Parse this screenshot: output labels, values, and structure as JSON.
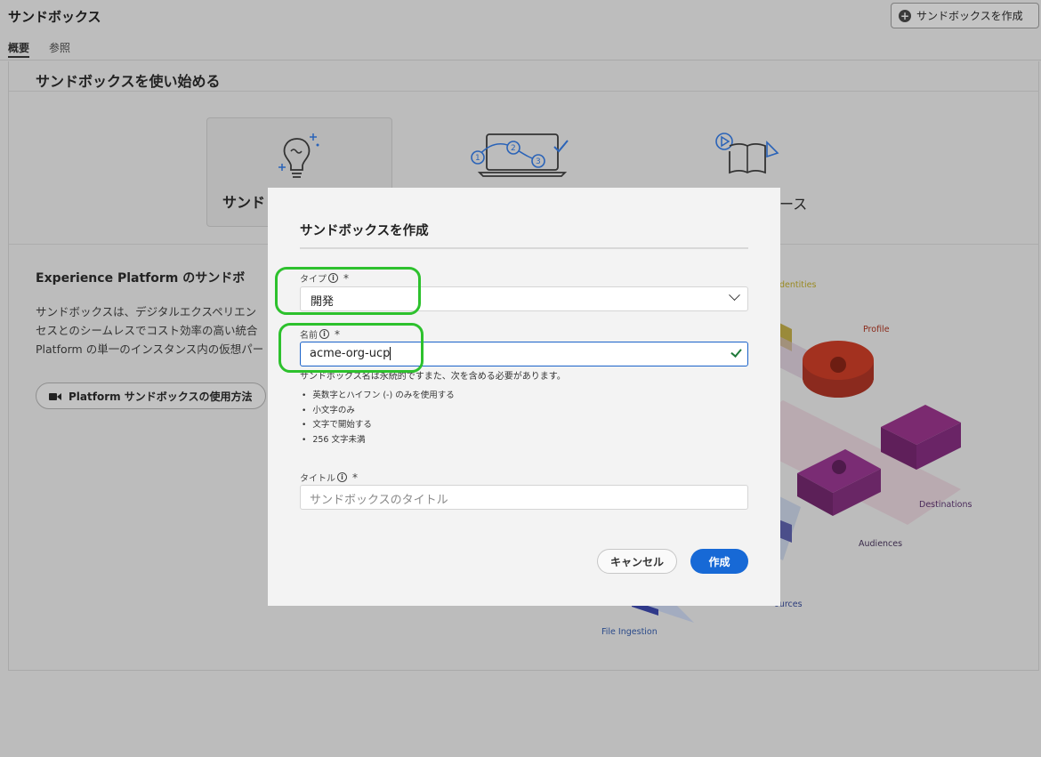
{
  "header": {
    "title": "サンドボックス",
    "create_button_label": "サンドボックスを作成",
    "tabs": [
      {
        "label": "概要",
        "active": true
      },
      {
        "label": "参照",
        "active": false
      }
    ]
  },
  "getting_started": {
    "title": "サンドボックスを使い始める",
    "cards": [
      {
        "label": "サンド",
        "icon": "lightbulb-icon"
      },
      {
        "label": "",
        "icon": "laptop-steps-icon"
      },
      {
        "label": "ース",
        "icon": "book-play-icon"
      }
    ]
  },
  "about": {
    "title": "Experience Platform のサンドボ",
    "description_lines": [
      "サンドボックスは、デジタルエクスペリエン",
      "セスとのシームレスでコスト効率の高い統合",
      "Platform の単一のインスタンス内の仮想パー"
    ],
    "howto_button_label": "Platform サンドボックスの使用方法"
  },
  "diagram_labels": {
    "identities": "dentities",
    "profile": "Profile",
    "destinations": "Destinations",
    "audiences": "Audiences",
    "sources": "ources",
    "file_ingestion": "File Ingestion"
  },
  "modal": {
    "title": "サンドボックスを作成",
    "type_field": {
      "label": "タイプ",
      "required_mark": "*",
      "value": "開発"
    },
    "name_field": {
      "label": "名前",
      "required_mark": "*",
      "value": "acme-org-ucp"
    },
    "name_help": "サンドボックス名は永続的ですまた、次を含める必要があります。",
    "name_rules": [
      "英数字とハイフン (-) のみを使用する",
      "小文字のみ",
      "文字で開始する",
      "256 文字未満"
    ],
    "title_field": {
      "label": "タイトル",
      "required_mark": "*",
      "placeholder": "サンドボックスのタイトル"
    },
    "cancel_label": "キャンセル",
    "create_label": "作成"
  },
  "colors": {
    "primary_button": "#1769d6",
    "highlight": "#2dc12d",
    "valid_check": "#1f7a3a"
  }
}
